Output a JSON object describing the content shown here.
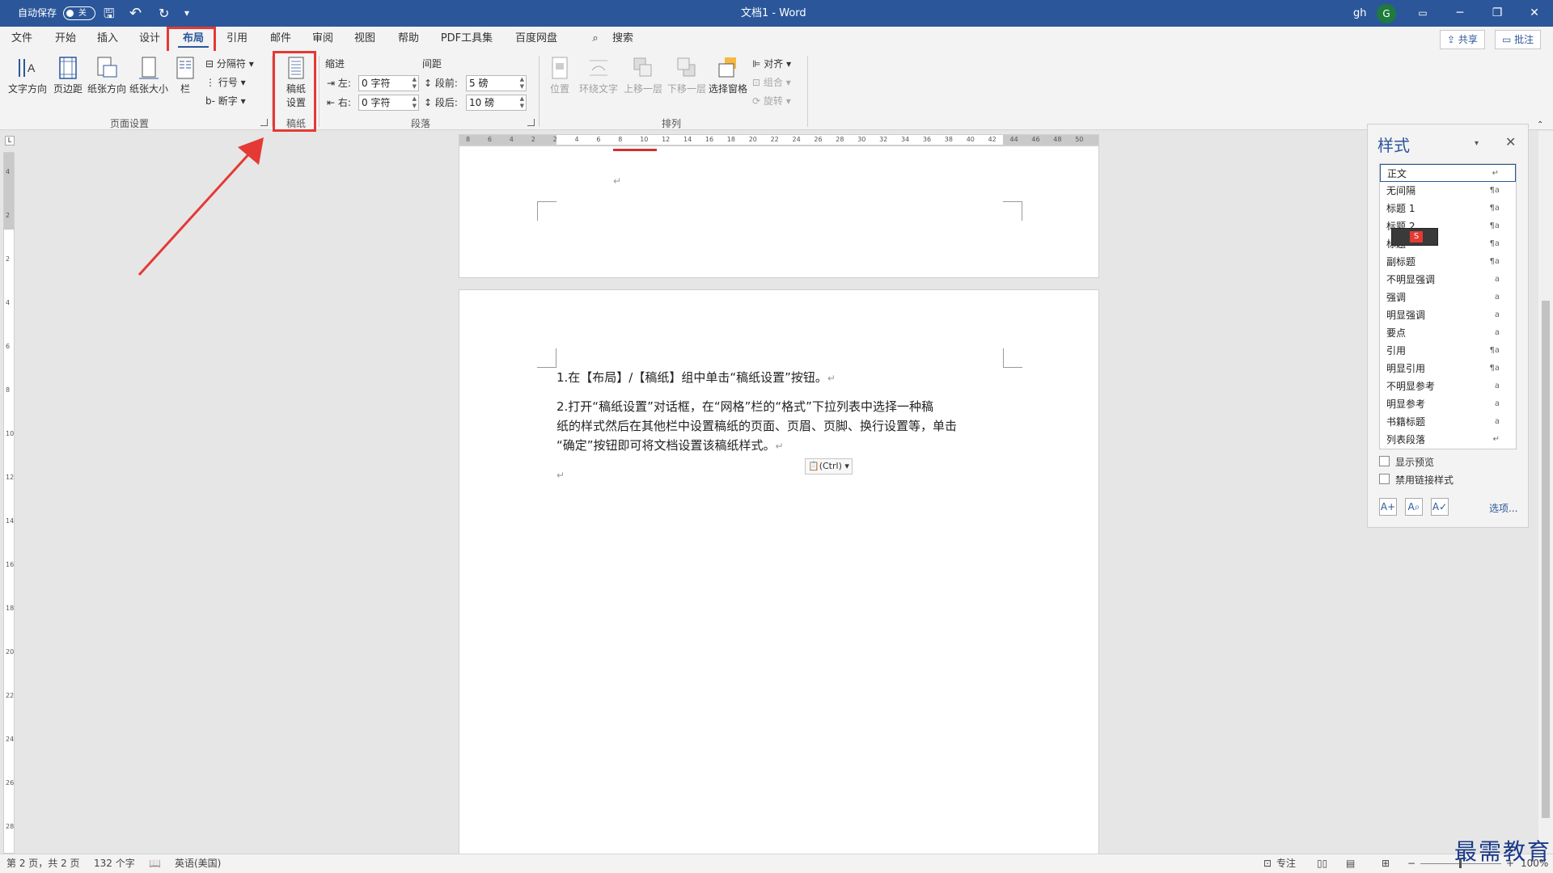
{
  "titlebar": {
    "autosave_label": "自动保存",
    "autosave_state": "关",
    "doc_title": "文档1 - Word",
    "user_name": "gh",
    "user_initial": "G",
    "qat": {
      "save": "🖫",
      "undo": "↶",
      "redo": "↻",
      "more": "▾"
    }
  },
  "tabs": [
    "文件",
    "开始",
    "插入",
    "设计",
    "布局",
    "引用",
    "邮件",
    "审阅",
    "视图",
    "帮助",
    "PDF工具集",
    "百度网盘"
  ],
  "active_tab": "布局",
  "search_label": "搜索",
  "share_label": "共享",
  "comments_label": "批注",
  "ribbon": {
    "page_setup": {
      "buttons": [
        "文字方向",
        "页边距",
        "纸张方向",
        "纸张大小",
        "栏"
      ],
      "small": [
        "分隔符",
        "行号",
        "断字"
      ],
      "group_label": "页面设置"
    },
    "manuscript": {
      "button_line1": "稿纸",
      "button_line2": "设置",
      "group_label": "稿纸"
    },
    "paragraph": {
      "indent_label": "缩进",
      "spacing_label": "间距",
      "left_label": "左:",
      "right_label": "右:",
      "before_label": "段前:",
      "after_label": "段后:",
      "left_value": "0 字符",
      "right_value": "0 字符",
      "before_value": "5 磅",
      "after_value": "10 磅",
      "group_label": "段落"
    },
    "arrange": {
      "buttons": [
        "位置",
        "环绕文字",
        "上移一层",
        "下移一层",
        "选择窗格"
      ],
      "small": [
        "对齐",
        "组合",
        "旋转"
      ],
      "group_label": "排列"
    }
  },
  "ruler_numbers": [
    "8",
    "6",
    "4",
    "2",
    "2",
    "4",
    "6",
    "8",
    "10",
    "12",
    "14",
    "16",
    "18",
    "20",
    "22",
    "24",
    "26",
    "28",
    "30",
    "32",
    "34",
    "36",
    "38",
    "40",
    "42",
    "44",
    "46",
    "48",
    "50"
  ],
  "vruler_numbers": [
    "4",
    "2",
    "2",
    "4",
    "6",
    "8",
    "10",
    "12",
    "14",
    "16",
    "18",
    "20",
    "22",
    "24",
    "26",
    "28"
  ],
  "document": {
    "para1": "1.在【布局】/【稿纸】组中单击“稿纸设置”按钮。",
    "para2_line1": "2.打开“稿纸设置”对话框，在“网格”栏的“格式”下拉列表中选择一种稿",
    "para2_line2": "纸的样式然后在其他栏中设置稿纸的页面、页眉、页脚、换行设置等，单击",
    "para2_line3": "“确定”按钮即可将文档设置该稿纸样式。",
    "para_mark": "↵",
    "paste_label": "(Ctrl)"
  },
  "styles_pane": {
    "title": "样式",
    "items": [
      {
        "name": "正文",
        "sym": "↵"
      },
      {
        "name": "无间隔",
        "sym": "¶a"
      },
      {
        "name": "标题 1",
        "sym": "¶a"
      },
      {
        "name": "标题 2",
        "sym": "¶a"
      },
      {
        "name": "标题",
        "sym": "¶a"
      },
      {
        "name": "副标题",
        "sym": "¶a"
      },
      {
        "name": "不明显强调",
        "sym": "a"
      },
      {
        "name": "强调",
        "sym": "a"
      },
      {
        "name": "明显强调",
        "sym": "a"
      },
      {
        "name": "要点",
        "sym": "a"
      },
      {
        "name": "引用",
        "sym": "¶a"
      },
      {
        "name": "明显引用",
        "sym": "¶a"
      },
      {
        "name": "不明显参考",
        "sym": "a"
      },
      {
        "name": "明显参考",
        "sym": "a"
      },
      {
        "name": "书籍标题",
        "sym": "a"
      },
      {
        "name": "列表段落",
        "sym": "↵"
      }
    ],
    "show_preview": "显示预览",
    "disable_linked": "禁用链接样式",
    "options": "选项..."
  },
  "statusbar": {
    "page": "第 2 页，共 2 页",
    "words": "132 个字",
    "language": "英语(美国)",
    "focus": "专注",
    "zoom": "100%"
  },
  "watermark": "最需教育",
  "colors": {
    "accent": "#2b579a",
    "highlight": "#e53935"
  }
}
